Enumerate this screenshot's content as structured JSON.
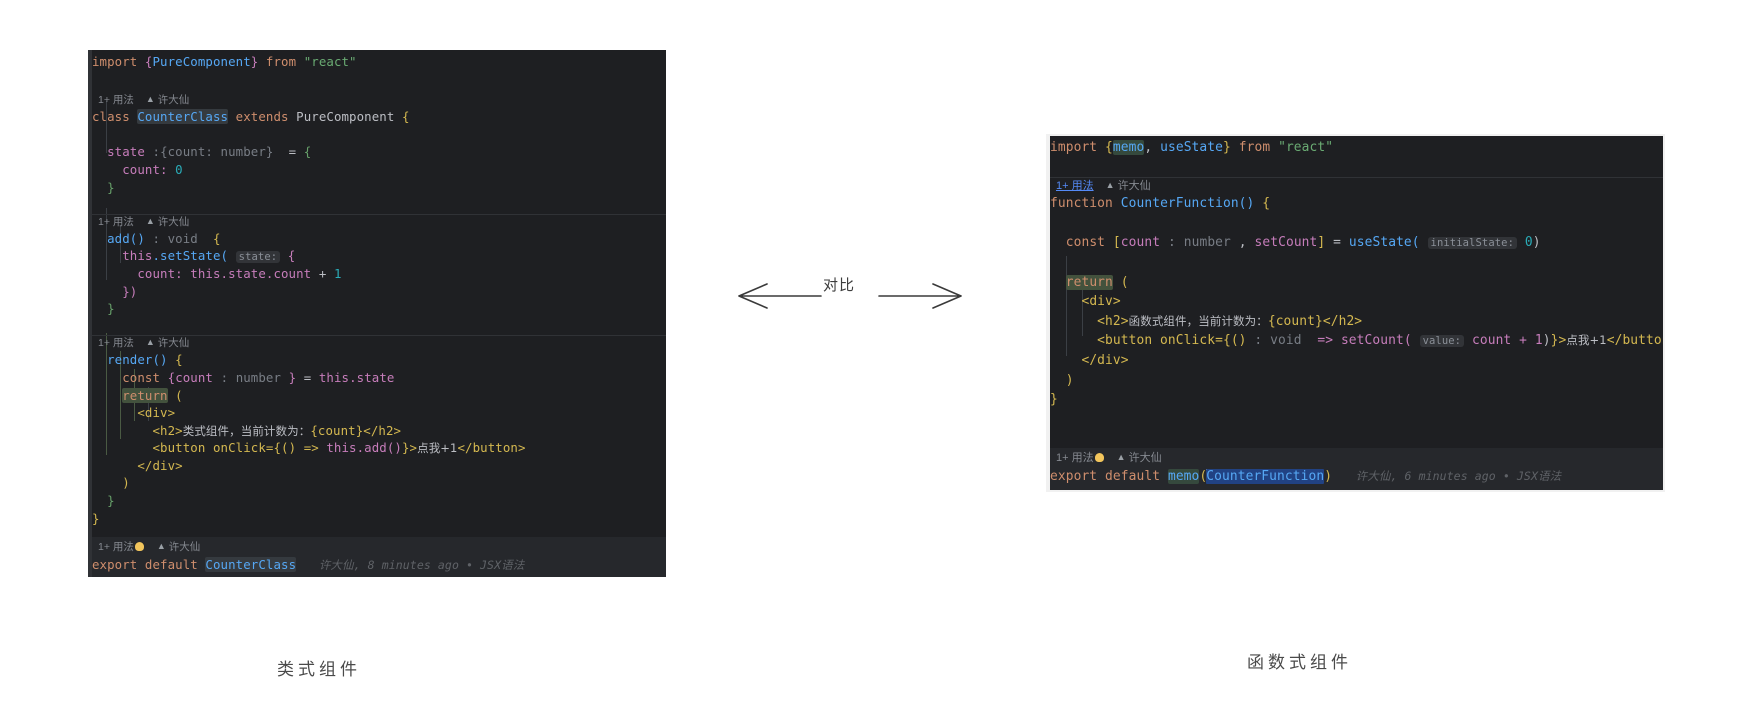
{
  "page": {
    "background": "#ffffff",
    "editor_background": "#1e1f22"
  },
  "annotation": {
    "arrow_label": "对比",
    "caption_left": "类式组件",
    "caption_right": "函数式组件"
  },
  "left_panel": {
    "name": "class-component-code",
    "lines": {
      "l01": {
        "import_kw": "import",
        "brace_open": "{",
        "named": "PureComponent",
        "brace_close": "}",
        "from_kw": "from",
        "module": "\"react\""
      },
      "hint1": {
        "usages": "1+ 用法",
        "author": "许大仙"
      },
      "l03": {
        "class_kw": "class",
        "name": "CounterClass",
        "extends_kw": "extends",
        "base": "PureComponent",
        "brace": "{"
      },
      "l05": {
        "state_kw": "state",
        "colon": ":",
        "type": "{count: number}",
        "eq": "=",
        "brace": "{"
      },
      "l06": {
        "key": "count:",
        "value": "0"
      },
      "l07": {
        "brace": "}"
      },
      "hint2": {
        "usages": "1+ 用法",
        "author": "许大仙"
      },
      "l09": {
        "method": "add()",
        "colon": ":",
        "ret_type": "void",
        "brace": "{"
      },
      "l10": {
        "this_kw": "this",
        "dot_call": ".setState(",
        "inlay": "state:",
        "brace": "{"
      },
      "l11": {
        "key": "count:",
        "expr": "this.state.count",
        "op": "+",
        "num": "1"
      },
      "l12": {
        "close": "})"
      },
      "l13": {
        "brace": "}"
      },
      "hint3": {
        "usages": "1+ 用法",
        "author": "许大仙"
      },
      "l15": {
        "method": "render()",
        "brace": "{"
      },
      "l16": {
        "const_kw": "const",
        "brace_open": "{",
        "ident": "count",
        "colon": ":",
        "type": "number",
        "brace_close": "}",
        "eq": "=",
        "expr": "this.state"
      },
      "l17": {
        "return_kw": "return",
        "paren": "("
      },
      "l18": {
        "tag": "<div>"
      },
      "l19": {
        "open": "<h2>",
        "text": "类式组件，当前计数为：",
        "expr": "{count}",
        "close": "</h2>"
      },
      "l20": {
        "open": "<button onClick=",
        "handler_open": "{() => ",
        "handler": "this.add()",
        "handler_close": "}",
        "gt": ">",
        "text": "点我+1",
        "close": "</button>"
      },
      "l21": {
        "tag": "</div>"
      },
      "l22": {
        "paren": ")"
      },
      "l23": {
        "brace": "}"
      },
      "l24": {
        "brace": "}"
      },
      "hint4": {
        "usages": "1+ 用法",
        "author": "许大仙"
      },
      "l26": {
        "export_kw": "export",
        "default_kw": "default",
        "ident": "CounterClass",
        "blame": "许大仙, 8 minutes ago • JSX语法"
      }
    }
  },
  "right_panel": {
    "name": "function-component-code",
    "lines": {
      "l01": {
        "import_kw": "import",
        "brace_open": "{",
        "named1": "memo",
        "comma": ",",
        "named2": " useState",
        "brace_close": "}",
        "from_kw": "from",
        "module": "\"react\""
      },
      "hint1": {
        "usages": "1+ 用法",
        "author": "许大仙",
        "usages_is_link": true
      },
      "l03": {
        "function_kw": "function",
        "name": "CounterFunction()",
        "brace": "{"
      },
      "l05": {
        "const_kw": "const",
        "bracket_open": "[",
        "ident": "count",
        "colon": ":",
        "type": "number",
        "comma": ",",
        "setter": " setCount",
        "bracket_close": "]",
        "eq": "=",
        "hook": "useState(",
        "inlay": "initialState:",
        "arg": "0",
        "paren_close": ")"
      },
      "l07": {
        "return_kw": "return",
        "paren": "("
      },
      "l08": {
        "tag": "<div>"
      },
      "l09": {
        "open": "<h2>",
        "text": "函数式组件，当前计数为：",
        "expr": "{count}",
        "close": "</h2>"
      },
      "l10": {
        "open": "<button onClick=",
        "handler_open": "{()",
        "colon": ":",
        "ret_type": "void",
        "arrow": "=> setCount(",
        "inlay": "value:",
        "expr": "count + 1",
        "paren_close": ")",
        "brace_close": "}",
        "gt": ">",
        "text": "点我+1",
        "close": "</button>"
      },
      "l11": {
        "tag": "</div>"
      },
      "l12": {
        "paren": ")"
      },
      "l13": {
        "brace": "}"
      },
      "hint2": {
        "usages": "1+ 用法",
        "author": "许大仙"
      },
      "l16": {
        "export_kw": "export",
        "default_kw": "default",
        "memo": "memo",
        "paren_open": "(",
        "ident": "CounterFunction",
        "paren_close": ")",
        "blame": "许大仙, 6 minutes ago • JSX语法"
      }
    }
  }
}
